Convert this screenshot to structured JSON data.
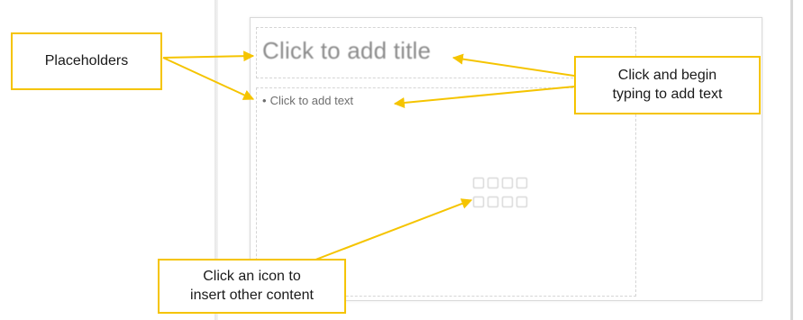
{
  "slide": {
    "title_placeholder": "Click to add title",
    "body_placeholder": {
      "bullet": "•",
      "text": "Click to add text"
    },
    "content_icons": [
      "table-icon",
      "chart-icon",
      "smartart-icon",
      "picture-icon",
      "online-picture-icon",
      "video-icon",
      "icon-icon",
      "3d-model-icon"
    ]
  },
  "callouts": {
    "placeholders": "Placeholders",
    "typing_line1": "Click and begin",
    "typing_line2": "typing to add text",
    "icon_line1": "Click an icon to",
    "icon_line2": "insert other content"
  },
  "colors": {
    "callout_border": "#f5c400",
    "arrow": "#f5c400",
    "placeholder_text": "#8c8c8c"
  }
}
